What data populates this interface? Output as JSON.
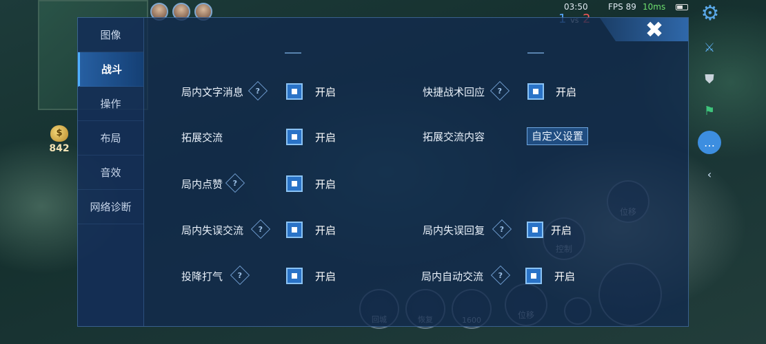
{
  "hud": {
    "gold": "842",
    "gold_icon": "$",
    "time": "03:50",
    "score_blue": "1",
    "score_vs": "vs",
    "score_red": "2",
    "fps": "FPS 89",
    "ping": "10ms",
    "skills": {
      "move1": "位移",
      "control": "控制",
      "spell1": "回城",
      "spell2": "恢复",
      "spell3": "1600",
      "move2": "位移"
    }
  },
  "sidebar": {
    "items": [
      {
        "label": "图像",
        "active": false
      },
      {
        "label": "战斗",
        "active": true
      },
      {
        "label": "操作",
        "active": false
      },
      {
        "label": "布局",
        "active": false
      },
      {
        "label": "音效",
        "active": false
      },
      {
        "label": "网络诊断",
        "active": false
      }
    ]
  },
  "close": {
    "symbol": "✖"
  },
  "settings": {
    "help_symbol": "?",
    "on_label": "开启",
    "text_message": {
      "label": "局内文字消息",
      "value": "开启",
      "checked": true
    },
    "quick_tactic": {
      "label": "快捷战术回应",
      "value": "开启",
      "checked": true
    },
    "extended_chat": {
      "label": "拓展交流",
      "value": "开启",
      "checked": true
    },
    "extended_chat_content": {
      "label": "拓展交流内容",
      "button": "自定义设置"
    },
    "like": {
      "label": "局内点赞",
      "value": "开启",
      "checked": true
    },
    "mistake_chat": {
      "label": "局内失误交流",
      "value": "开启",
      "checked": true
    },
    "mistake_reply": {
      "label": "局内失误回复",
      "value": "开启",
      "checked": true
    },
    "surrender_cheer": {
      "label": "投降打气",
      "value": "开启",
      "checked": true
    },
    "auto_chat": {
      "label": "局内自动交流",
      "value": "开启",
      "checked": true
    }
  },
  "colors": {
    "panel_bg": "#122a4e",
    "accent": "#2a73c7",
    "active_tab": "#2864aa"
  }
}
